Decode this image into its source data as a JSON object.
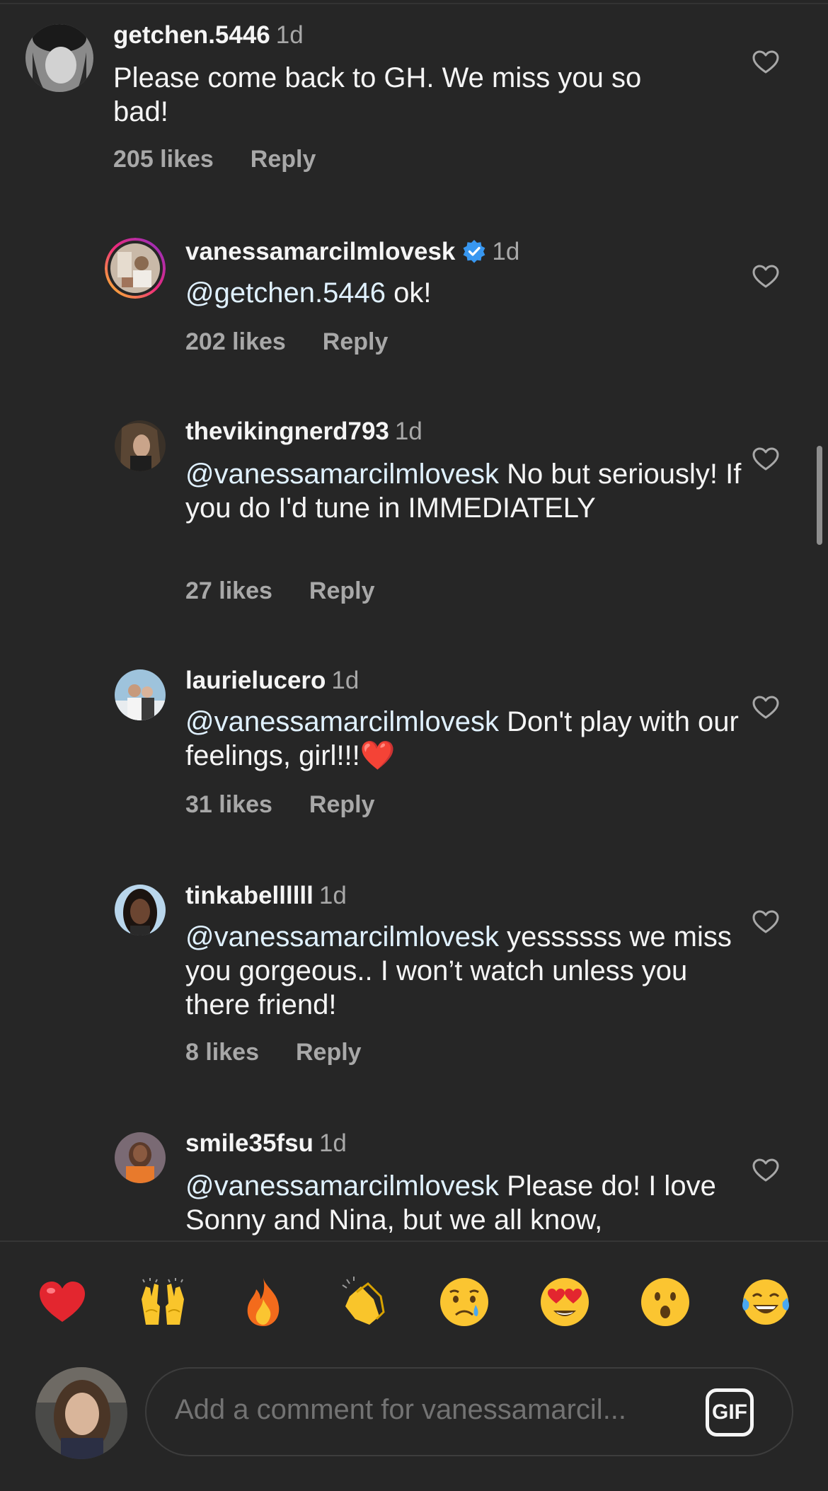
{
  "comments": [
    {
      "username": "getchen.5446",
      "time": "1d",
      "text": "Please come back to GH. We miss you so bad!",
      "likes": "205 likes",
      "reply": "Reply"
    },
    {
      "username": "vanessamarcilmlovesk",
      "time": "1d",
      "verified": true,
      "mention": "@getchen.5446",
      "text": " ok!",
      "likes": "202 likes",
      "reply": "Reply"
    },
    {
      "username": "thevikingnerd793",
      "time": "1d",
      "mention": "@vanessamarcilmlovesk",
      "text": " No but seriously! If you do I'd tune in IMMEDIATELY",
      "likes": "27 likes",
      "reply": "Reply"
    },
    {
      "username": "laurielucero",
      "time": "1d",
      "mention": "@vanessamarcilmlovesk",
      "text": " Don't play with our feelings, girl!!!❤️",
      "likes": "31 likes",
      "reply": "Reply"
    },
    {
      "username": "tinkabellllll",
      "time": "1d",
      "mention": "@vanessamarcilmlovesk",
      "text": " yessssss we miss you gorgeous.. I won’t watch unless you there friend!",
      "likes": "8 likes",
      "reply": "Reply"
    },
    {
      "username": "smile35fsu",
      "time": "1d",
      "mention": "@vanessamarcilmlovesk",
      "text": " Please do! I love Sonny and Nina, but we all know,"
    }
  ],
  "reactions": [
    "heart-emoji",
    "raising-hands-emoji",
    "fire-emoji",
    "clapping-hands-emoji",
    "crying-face-emoji",
    "heart-eyes-emoji",
    "surprised-face-emoji",
    "tears-of-joy-emoji"
  ],
  "composer": {
    "placeholder": "Add a comment for vanessamarcil...",
    "gif_label": "GIF"
  },
  "colors": {
    "background": "#262626",
    "text": "#f5f5f5",
    "secondary": "#a8a8a8",
    "mention": "#e0f1ff",
    "verified": "#3897f0"
  }
}
